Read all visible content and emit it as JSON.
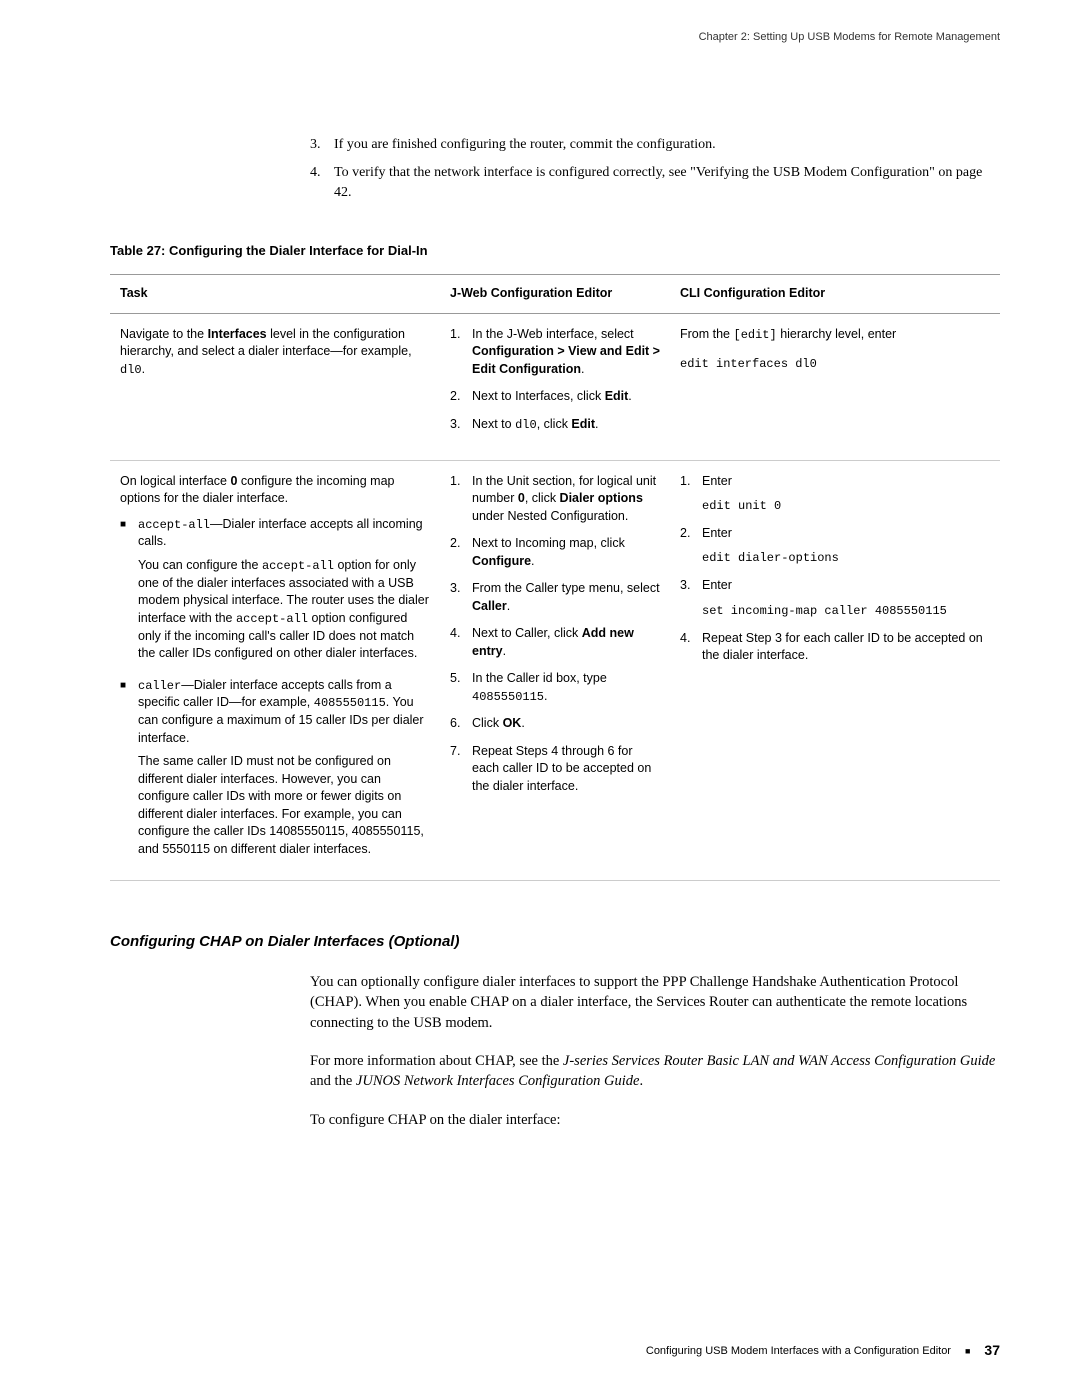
{
  "header": {
    "chapter_line": "Chapter 2: Setting Up USB Modems for Remote Management"
  },
  "top_list": {
    "items": [
      {
        "num": "3.",
        "text": "If you are finished configuring the router, commit the configuration."
      },
      {
        "num": "4.",
        "text": "To verify that the network interface is configured correctly, see \"Verifying the USB Modem Configuration\" on page 42."
      }
    ]
  },
  "table": {
    "caption": "Table 27: Configuring the Dialer Interface for Dial-In",
    "headers": {
      "c1": "Task",
      "c2": "J-Web Configuration Editor",
      "c3": "CLI Configuration Editor"
    },
    "row1": {
      "task_pre": "Navigate to the ",
      "task_bold": "Interfaces",
      "task_post": " level in the configuration hierarchy, and select a dialer interface—for example, ",
      "task_iface": "dl0",
      "task_dot": ".",
      "jweb": [
        {
          "n": "1.",
          "pre": "In the J-Web interface, select ",
          "b": "Configuration > View and Edit > Edit Configuration",
          "post": "."
        },
        {
          "n": "2.",
          "pre": "Next to Interfaces, click ",
          "b": "Edit",
          "post": "."
        },
        {
          "n": "3.",
          "pre": "Next to ",
          "mono": "dl0",
          "mid": ", click ",
          "b": "Edit",
          "post": "."
        }
      ],
      "cli": {
        "l1_pre": "From the ",
        "l1_b": "[edit]",
        "l1_post": " hierarchy level, enter",
        "l2": "edit interfaces dl0"
      }
    },
    "row2": {
      "task_intro_pre": "On logical interface ",
      "task_intro_b": "0",
      "task_intro_post": " configure the incoming map options for the dialer interface.",
      "bullets": [
        {
          "lead_mono": "accept-all",
          "lead_post": "—Dialer interface accepts all incoming calls.",
          "paras": [
            {
              "pre": "You can configure the ",
              "mono": "accept-all",
              "mid": " option for only one of the dialer interfaces associated with a USB modem physical interface. The router uses the dialer interface with the ",
              "mono2": "accept-all",
              "post": " option configured only if the incoming call's caller ID does not match the caller IDs configured on other dialer interfaces."
            }
          ]
        },
        {
          "lead_mono": "caller",
          "lead_post": "—Dialer interface accepts calls from a specific caller ID—for example, ",
          "lead_mono2": "4085550115",
          "lead_after": ". You can configure a maximum of 15 caller IDs per dialer interface.",
          "paras": [
            {
              "text": "The same caller ID must not be configured on different dialer interfaces. However, you can configure caller IDs with more or fewer digits on different dialer interfaces. For example, you can configure the caller IDs 14085550115, 4085550115, and 5550115 on different dialer interfaces."
            }
          ]
        }
      ],
      "jweb": [
        {
          "n": "1.",
          "pre": "In the Unit section, for logical unit number ",
          "b1": "0",
          "mid": ", click ",
          "b2": "Dialer options",
          "post": " under Nested Configuration."
        },
        {
          "n": "2.",
          "pre": "Next to Incoming map, click ",
          "b": "Configure",
          "post": "."
        },
        {
          "n": "3.",
          "pre": "From the Caller type menu, select ",
          "b": "Caller",
          "post": "."
        },
        {
          "n": "4.",
          "pre": "Next to Caller, click ",
          "b": "Add new entry",
          "post": "."
        },
        {
          "n": "5.",
          "pre": "In the Caller id box, type ",
          "mono": "4085550115",
          "post": "."
        },
        {
          "n": "6.",
          "pre": "Click ",
          "b": "OK",
          "post": "."
        },
        {
          "n": "7.",
          "text": "Repeat Steps 4 through 6 for each caller ID to be accepted on the dialer interface."
        }
      ],
      "cli": [
        {
          "n": "1.",
          "l1": "Enter",
          "l2": "edit unit 0"
        },
        {
          "n": "2.",
          "l1": "Enter",
          "l2": "edit dialer-options"
        },
        {
          "n": "3.",
          "l1": "Enter",
          "l2": "set incoming-map caller 4085550115"
        },
        {
          "n": "4.",
          "text": "Repeat Step 3 for each caller ID to be accepted on the dialer interface."
        }
      ]
    }
  },
  "section": {
    "heading": "Configuring CHAP on Dialer Interfaces (Optional)",
    "p1": "You can optionally configure dialer interfaces to support the PPP Challenge Handshake Authentication Protocol (CHAP). When you enable CHAP on a dialer interface, the Services Router can authenticate the remote locations connecting to the USB modem.",
    "p2_pre": "For more information about CHAP, see the ",
    "p2_i1": "J-series Services Router Basic LAN and WAN Access Configuration Guide",
    "p2_mid": " and the ",
    "p2_i2": "JUNOS Network Interfaces Configuration Guide",
    "p2_post": ".",
    "p3": "To configure CHAP on the dialer interface:"
  },
  "footer": {
    "text": "Configuring USB Modem Interfaces with a Configuration Editor",
    "page": "37"
  }
}
